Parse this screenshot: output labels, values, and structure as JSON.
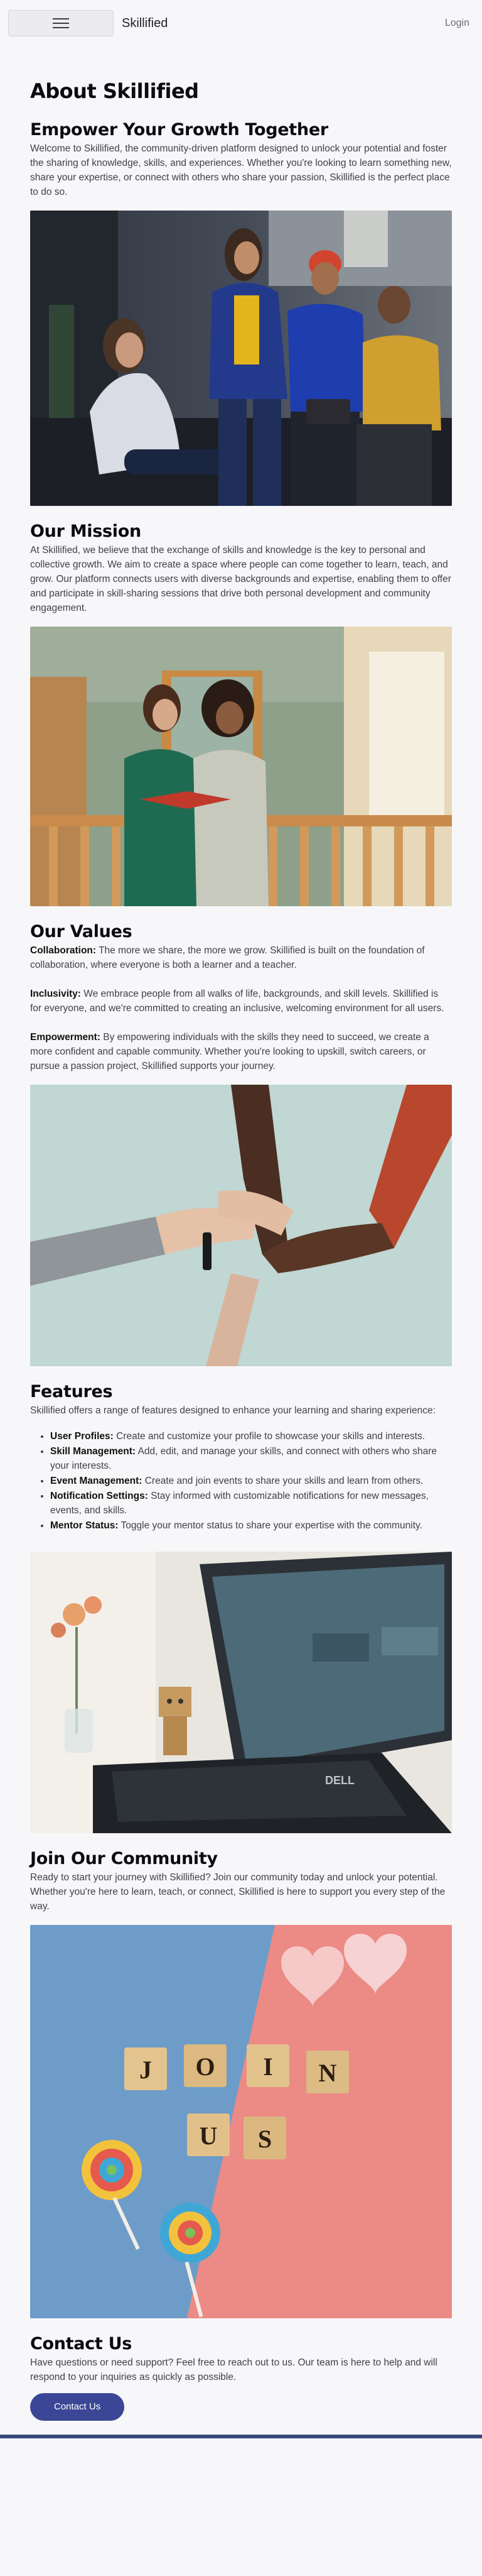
{
  "nav": {
    "brand": "Skillified",
    "login": "Login"
  },
  "page_title": "About Skillified",
  "sections": {
    "growth": {
      "heading": "Empower Your Growth Together",
      "body": "Welcome to Skillified, the community-driven platform designed to unlock your potential and foster the sharing of knowledge, skills, and experiences. Whether you're looking to learn something new, share your expertise, or connect with others who share your passion, Skillified is the perfect place to do so."
    },
    "mission": {
      "heading": "Our Mission",
      "body": "At Skillified, we believe that the exchange of skills and knowledge is the key to personal and collective growth. We aim to create a space where people can come together to learn, teach, and grow. Our platform connects users with diverse backgrounds and expertise, enabling them to offer and participate in skill-sharing sessions that drive both personal development and community engagement."
    },
    "values": {
      "heading": "Our Values",
      "items": [
        {
          "term": "Collaboration:",
          "text": " The more we share, the more we grow. Skillified is built on the foundation of collaboration, where everyone is both a learner and a teacher."
        },
        {
          "term": "Inclusivity:",
          "text": " We embrace people from all walks of life, backgrounds, and skill levels. Skillified is for everyone, and we're committed to creating an inclusive, welcoming environment for all users."
        },
        {
          "term": "Empowerment:",
          "text": " By empowering individuals with the skills they need to succeed, we create a more confident and capable community. Whether you're looking to upskill, switch careers, or pursue a passion project, Skillified supports your journey."
        }
      ]
    },
    "features": {
      "heading": "Features",
      "intro": "Skillified offers a range of features designed to enhance your learning and sharing experience:",
      "items": [
        {
          "term": "User Profiles:",
          "text": " Create and customize your profile to showcase your skills and interests."
        },
        {
          "term": "Skill Management:",
          "text": " Add, edit, and manage your skills, and connect with others who share your interests."
        },
        {
          "term": "Event Management:",
          "text": " Create and join events to share your skills and learn from others."
        },
        {
          "term": "Notification Settings:",
          "text": " Stay informed with customizable notifications for new messages, events, and skills."
        },
        {
          "term": "Mentor Status:",
          "text": " Toggle your mentor status to share your expertise with the community."
        }
      ]
    },
    "community": {
      "heading": "Join Our Community",
      "body": "Ready to start your journey with Skillified? Join our community today and unlock your potential. Whether you're here to learn, teach, or connect, Skillified is here to support you every step of the way."
    },
    "contact": {
      "heading": "Contact Us",
      "body": "Have questions or need support? Feel free to reach out to us. Our team is here to help and will respond to your inquiries as quickly as possible.",
      "button": "Contact Us"
    }
  },
  "join_tiles": {
    "row1": [
      "J",
      "O",
      "I",
      "N"
    ],
    "row2": [
      "U",
      "S"
    ]
  },
  "laptop_brand": "DELL",
  "colors": {
    "accent": "#3b4796",
    "footer": "#384b7c",
    "background": "#f7f7f9"
  }
}
